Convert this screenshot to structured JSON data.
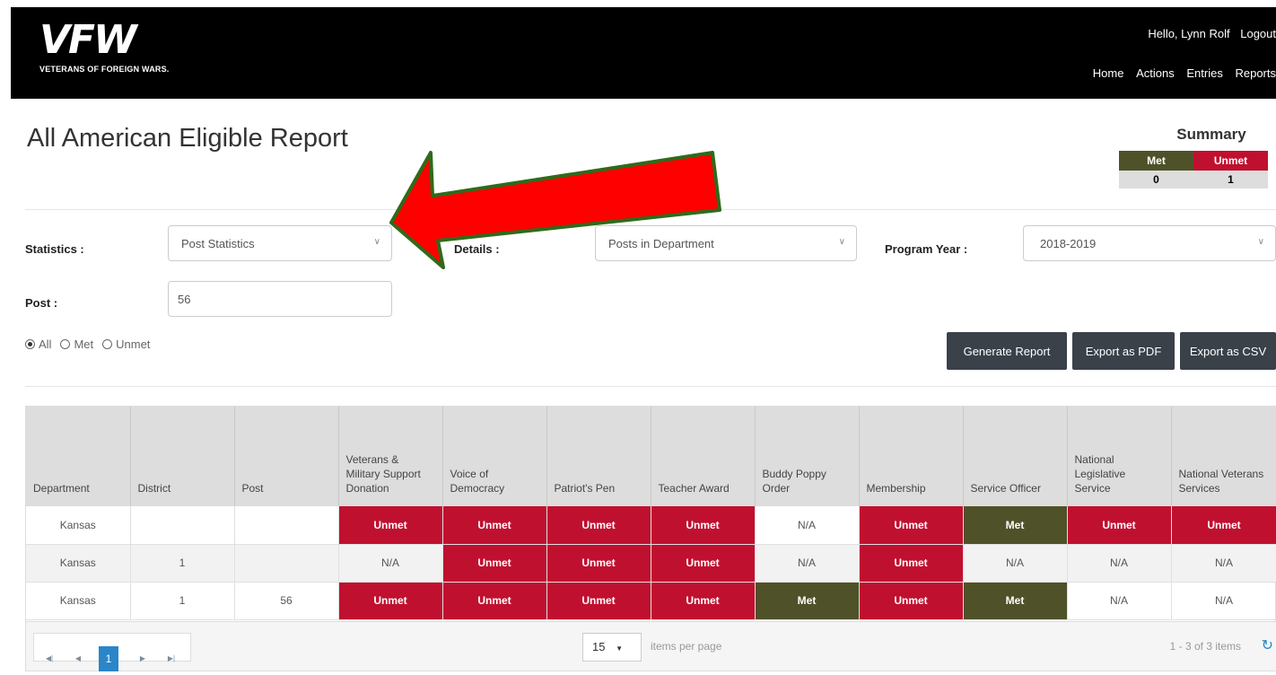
{
  "header": {
    "logo_text": "VFW",
    "logo_subtitle": "VETERANS OF FOREIGN WARS.",
    "greeting": "Hello, Lynn Rolf",
    "logout": "Logout",
    "nav": [
      "Home",
      "Actions",
      "Entries",
      "Reports"
    ]
  },
  "page": {
    "title": "All American Eligible Report"
  },
  "summary": {
    "title": "Summary",
    "met_label": "Met",
    "unmet_label": "Unmet",
    "met_value": "0",
    "unmet_value": "1"
  },
  "filters": {
    "statistics_label": "Statistics :",
    "statistics_value": "Post Statistics",
    "details_label": "Details :",
    "details_value": "Posts in Department",
    "program_year_label": "Program Year :",
    "program_year_value": "2018-2019",
    "post_label": "Post :",
    "post_value": "56",
    "radio_all": "All",
    "radio_met": "Met",
    "radio_unmet": "Unmet",
    "selected_radio": "All"
  },
  "buttons": {
    "generate": "Generate Report",
    "export_pdf": "Export as PDF",
    "export_csv": "Export as CSV"
  },
  "table": {
    "columns": [
      "Department",
      "District",
      "Post",
      "Veterans & Military Support Donation",
      "Voice of Democracy",
      "Patriot's Pen",
      "Teacher Award",
      "Buddy Poppy Order",
      "Membership",
      "Service Officer",
      "National Legislative Service",
      "National Veterans Services"
    ],
    "rows": [
      [
        "Kansas",
        "",
        "",
        "Unmet",
        "Unmet",
        "Unmet",
        "Unmet",
        "N/A",
        "Unmet",
        "Met",
        "Unmet",
        "Unmet"
      ],
      [
        "Kansas",
        "1",
        "",
        "N/A",
        "Unmet",
        "Unmet",
        "Unmet",
        "N/A",
        "Unmet",
        "N/A",
        "N/A",
        "N/A"
      ],
      [
        "Kansas",
        "1",
        "56",
        "Unmet",
        "Unmet",
        "Unmet",
        "Unmet",
        "Met",
        "Unmet",
        "Met",
        "N/A",
        "N/A"
      ]
    ]
  },
  "pager": {
    "current_page": "1",
    "page_size": "15",
    "per_page_label": "items per page",
    "items_info": "1 - 3 of 3 items"
  },
  "colors": {
    "met": "#4f5228",
    "unmet": "#c0102f",
    "annotation_arrow": "#ff0000"
  }
}
